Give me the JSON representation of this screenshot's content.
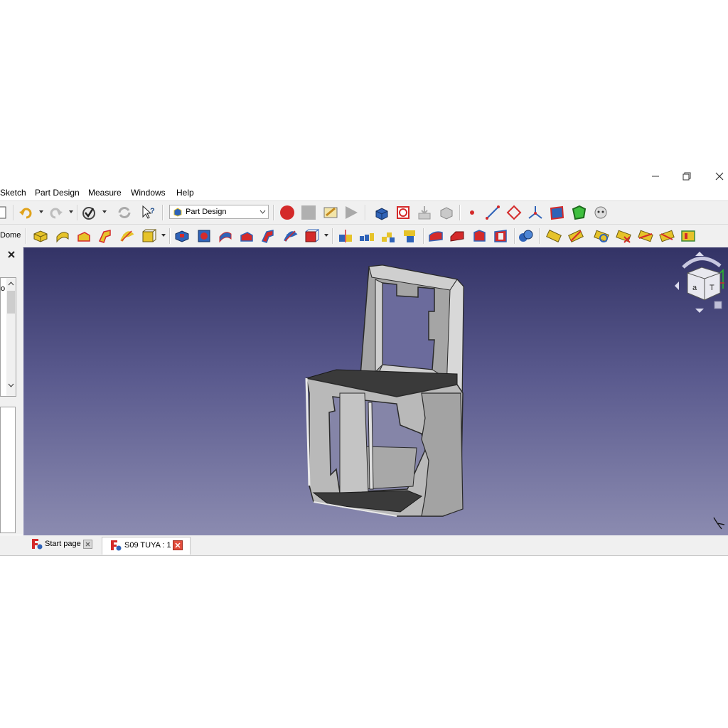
{
  "menu": {
    "items": [
      "Sketch",
      "Part Design",
      "Measure",
      "Windows",
      "Help"
    ]
  },
  "toolbar": {
    "workbench_value": "Part Design"
  },
  "left_panel": {
    "dome_label": "Dome",
    "clipped_text": "o"
  },
  "tabs": [
    {
      "label": "Start page"
    },
    {
      "label": "S09 TUYA : 1"
    }
  ],
  "colors": {
    "accent_red": "#d42a2a",
    "tool_blue": "#2f63b8",
    "tool_yellow": "#e6c32a",
    "viewport_top": "#333366",
    "viewport_bottom": "#8b8bb0"
  },
  "nav_cube": {
    "face_left": "a",
    "face_right": "T"
  }
}
